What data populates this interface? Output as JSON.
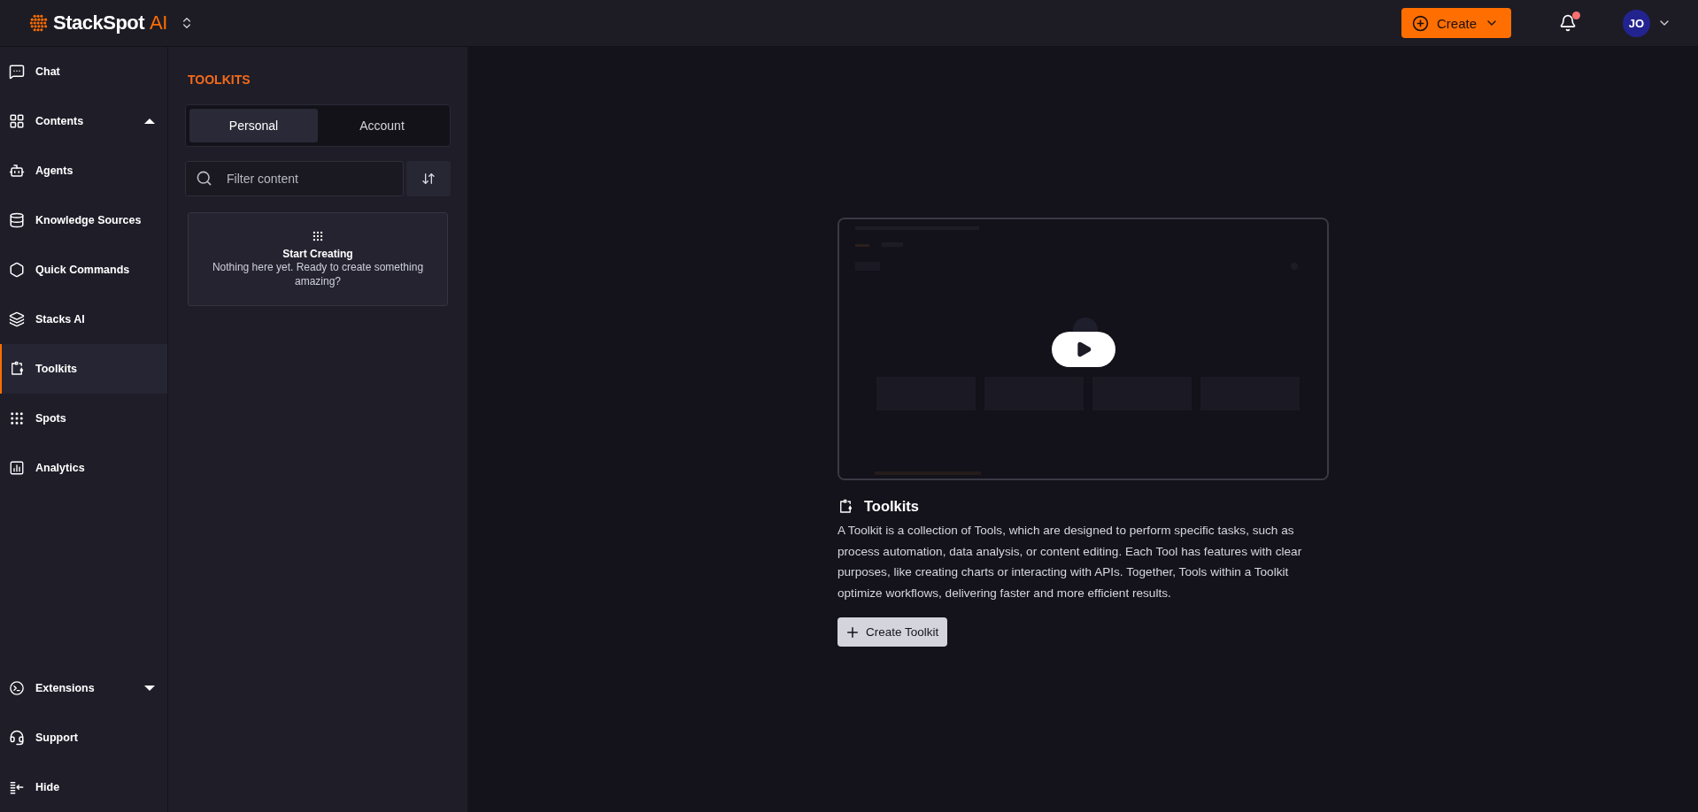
{
  "topbar": {
    "logo": {
      "name": "StackSpot",
      "suffix": "AI"
    },
    "create_button": "Create",
    "notifications": {
      "unread": true
    },
    "avatar": "JO"
  },
  "sidebar": {
    "top": [
      {
        "label": "Chat",
        "selected": false
      }
    ],
    "contents": {
      "label": "Contents",
      "expanded": true,
      "items": [
        {
          "label": "Agents",
          "selected": false
        },
        {
          "label": "Knowledge Sources",
          "selected": false
        },
        {
          "label": "Quick Commands",
          "selected": false
        },
        {
          "label": "Stacks AI",
          "selected": false
        },
        {
          "label": "Toolkits",
          "selected": true
        },
        {
          "label": "Spots",
          "selected": false
        },
        {
          "label": "Analytics",
          "selected": false
        }
      ]
    },
    "extensions": {
      "label": "Extensions",
      "expanded": false
    },
    "footer": [
      {
        "label": "Support"
      },
      {
        "label": "Hide"
      }
    ]
  },
  "panel": {
    "title": "TOOLKITS",
    "tabs": [
      {
        "label": "Personal",
        "selected": true
      },
      {
        "label": "Account",
        "selected": false
      }
    ],
    "search": {
      "placeholder": "Filter content"
    },
    "empty_state": {
      "title": "Start Creating",
      "message": "Nothing here yet. Ready to create something amazing?"
    }
  },
  "main": {
    "title": "Toolkits",
    "description": "A Toolkit is a collection of Tools, which are designed to perform specific tasks, such as process automation, data analysis, or content editing. Each Tool has features with clear purposes, like creating charts or interacting with APIs. Together, Tools within a Toolkit optimize workflows, delivering faster and more efficient results.",
    "create_button": "Create Toolkit"
  }
}
